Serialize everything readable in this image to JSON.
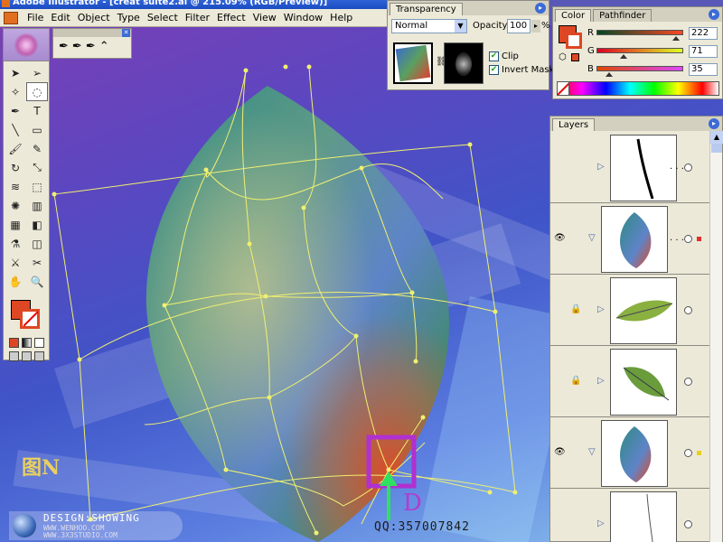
{
  "window": {
    "title": "Adobe Illustrator - [creat suite2.ai @ 215.09% (RGB/Preview)]"
  },
  "menu": {
    "items": [
      "File",
      "Edit",
      "Object",
      "Type",
      "Select",
      "Filter",
      "Effect",
      "View",
      "Window",
      "Help"
    ]
  },
  "toolbox": {
    "tools": [
      {
        "icon": "selection-arrow-icon",
        "glyph": "➤"
      },
      {
        "icon": "direct-selection-icon",
        "glyph": "➢"
      },
      {
        "icon": "magic-wand-icon",
        "glyph": "✧"
      },
      {
        "icon": "lasso-icon",
        "glyph": "◌"
      },
      {
        "icon": "pen-icon",
        "glyph": "✒"
      },
      {
        "icon": "type-icon",
        "glyph": "T"
      },
      {
        "icon": "line-icon",
        "glyph": "╲"
      },
      {
        "icon": "rectangle-icon",
        "glyph": "▭"
      },
      {
        "icon": "paintbrush-icon",
        "glyph": "🖌"
      },
      {
        "icon": "pencil-icon",
        "glyph": "✎"
      },
      {
        "icon": "rotate-icon",
        "glyph": "↻"
      },
      {
        "icon": "scale-icon",
        "glyph": "⤡"
      },
      {
        "icon": "warp-icon",
        "glyph": "≋"
      },
      {
        "icon": "free-transform-icon",
        "glyph": "⬚"
      },
      {
        "icon": "symbol-sprayer-icon",
        "glyph": "✺"
      },
      {
        "icon": "column-graph-icon",
        "glyph": "▥"
      },
      {
        "icon": "mesh-icon",
        "glyph": "▦"
      },
      {
        "icon": "gradient-icon",
        "glyph": "◧"
      },
      {
        "icon": "eyedropper-icon",
        "glyph": "⚗"
      },
      {
        "icon": "blend-icon",
        "glyph": "◫"
      },
      {
        "icon": "slice-icon",
        "glyph": "⚔"
      },
      {
        "icon": "scissors-icon",
        "glyph": "✂"
      },
      {
        "icon": "hand-icon",
        "glyph": "✋"
      },
      {
        "icon": "zoom-icon",
        "glyph": "🔍"
      }
    ],
    "fill_color": "#de4723",
    "stroke_color": "#de4723"
  },
  "pen_flyout": {
    "tools": [
      "pen-icon",
      "add-anchor-icon",
      "delete-anchor-icon",
      "convert-anchor-icon"
    ],
    "glyphs": [
      "✒",
      "✒",
      "✒",
      "⌃"
    ]
  },
  "transparency_panel": {
    "tab": "Transparency",
    "blend_mode": "Normal",
    "opacity_label": "Opacity:",
    "opacity_value": "100",
    "opacity_unit": "%",
    "clip_label": "Clip",
    "invert_mask_label": "Invert Mask",
    "clip_checked": true,
    "invert_checked": true
  },
  "color_panel": {
    "tabs": [
      "Color",
      "Pathfinder"
    ],
    "r_label": "R",
    "g_label": "G",
    "b_label": "B",
    "r_value": "222",
    "g_value": "71",
    "b_value": "35",
    "fill_hex": "#de4723"
  },
  "layers_panel": {
    "tab": "Layers",
    "rows": [
      {
        "visible": false,
        "locked": false,
        "expanded": false,
        "thumb": "stroke-curve",
        "dots": ". . .",
        "selected_color": ""
      },
      {
        "visible": true,
        "locked": false,
        "expanded": true,
        "thumb": "leaf-gradient",
        "dots": ". . .",
        "selected_color": "#e03030"
      },
      {
        "visible": false,
        "locked": true,
        "expanded": false,
        "thumb": "leaf-green",
        "dots": "",
        "selected_color": ""
      },
      {
        "visible": false,
        "locked": true,
        "expanded": false,
        "thumb": "leaf-green-2",
        "dots": "",
        "selected_color": ""
      },
      {
        "visible": true,
        "locked": false,
        "expanded": true,
        "thumb": "leaf-gradient",
        "dots": "",
        "selected_color": "#e8d020"
      },
      {
        "visible": false,
        "locked": false,
        "expanded": false,
        "thumb": "stroke-line",
        "dots": "",
        "selected_color": ""
      }
    ]
  },
  "canvas": {
    "figure_label": "图N",
    "marker_label": "D",
    "qq_text": "QQ:357007842"
  },
  "watermark": {
    "line1": "DESIGN:SHOWING",
    "line2": "WWW.WENHOO.COM",
    "line3": "WWW.3X3STUDIO.COM"
  }
}
